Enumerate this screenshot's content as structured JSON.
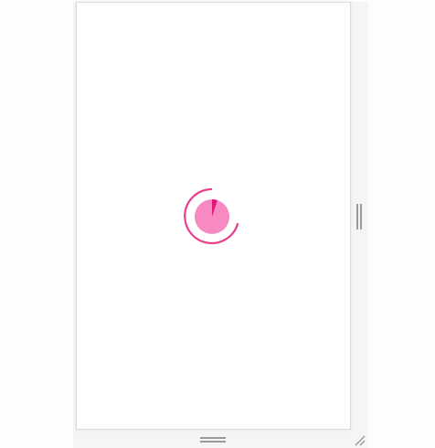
{
  "colors": {
    "accent": "#e83e8c",
    "spinner_fill": "#f78ac0",
    "spinner_wedge": "#e2177a",
    "handle": "#9a9a9a",
    "gutter": "#f5f5f5",
    "panel_background": "#ffffff"
  },
  "loader": {
    "icon": "loading-spinner-icon",
    "progress": 0.05
  },
  "resize_handles": {
    "right_icon": "vertical-grip-icon",
    "bottom_icon": "horizontal-grip-icon",
    "corner_icon": "resize-corner-icon"
  }
}
